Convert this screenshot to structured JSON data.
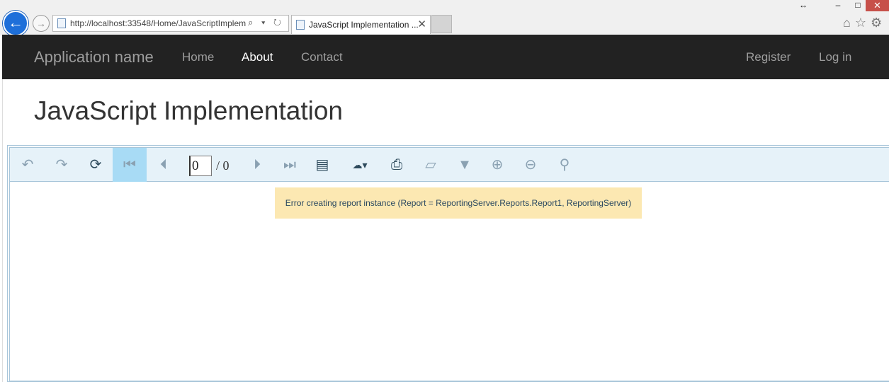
{
  "browser": {
    "window_controls": {
      "resize": "↔",
      "minimize": "–",
      "maximize": "□",
      "close": "✕"
    },
    "back_glyph": "←",
    "forward_glyph": "→",
    "address": "http://localhost:33548/Home/JavaScriptImplem",
    "address_icons": "⌕ ▾ ↻",
    "tab_title": "JavaScript Implementation ...",
    "tab_close": "✕",
    "toolbar_icons": "⌂☆⚙"
  },
  "navbar": {
    "brand": "Application name",
    "links": [
      "Home",
      "About",
      "Contact"
    ],
    "active": "About",
    "right_links": [
      "Register",
      "Log in"
    ]
  },
  "page": {
    "title": "JavaScript Implementation"
  },
  "viewer": {
    "toolbar": {
      "icons": {
        "back": "↶",
        "forward": "↷",
        "refresh": "⟳",
        "first": "⏮",
        "prev": "⏴",
        "next": "⏵",
        "last": "⏭",
        "document_map": "▤",
        "export": "☁▾",
        "print": "⎙",
        "print_preview": "▱",
        "parameters": "▼",
        "zoom_in": "⊕",
        "zoom_out": "⊖",
        "search": "⚲"
      },
      "page_number": "0",
      "page_total": "/ 0"
    },
    "error_message": "Error creating report instance (Report = ReportingServer.Reports.Report1, ReportingServer)"
  },
  "colors": {
    "navbar_bg": "#222222",
    "toolbar_bg": "#e6f2f9",
    "selected_button": "#a8dbf5",
    "error_bg": "#fce8b2"
  }
}
